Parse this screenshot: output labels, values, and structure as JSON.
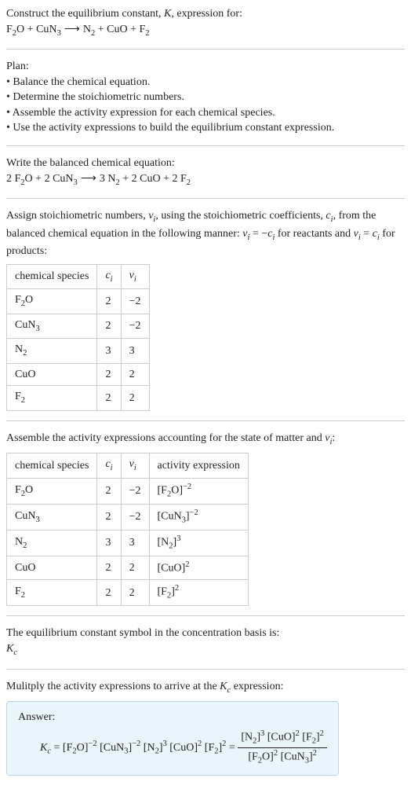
{
  "prompt": {
    "line1": "Construct the equilibrium constant, ",
    "K": "K",
    "line1b": ", expression for:"
  },
  "reaction_unbalanced": {
    "r1": "F",
    "r1s": "2",
    "r1b": "O",
    "plus1": " + ",
    "r2": "CuN",
    "r2s": "3",
    "arrow": " ⟶ ",
    "p1": "N",
    "p1s": "2",
    "plus2": " + ",
    "p2": "CuO",
    "plus3": " + ",
    "p3": "F",
    "p3s": "2"
  },
  "plan": {
    "title": "Plan:",
    "b1": "• Balance the chemical equation.",
    "b2": "• Determine the stoichiometric numbers.",
    "b3": "• Assemble the activity expression for each chemical species.",
    "b4": "• Use the activity expressions to build the equilibrium constant expression."
  },
  "balanced": {
    "title": "Write the balanced chemical equation:",
    "c1": "2 ",
    "r1": "F",
    "r1s": "2",
    "r1b": "O",
    "plus1": " + ",
    "c2": "2 ",
    "r2": "CuN",
    "r2s": "3",
    "arrow": " ⟶ ",
    "c3": "3 ",
    "p1": "N",
    "p1s": "2",
    "plus2": " + ",
    "c4": "2 ",
    "p2": "CuO",
    "plus3": " + ",
    "c5": "2 ",
    "p3": "F",
    "p3s": "2"
  },
  "assign1": {
    "t1": "Assign stoichiometric numbers, ",
    "nu": "ν",
    "nui": "i",
    "t2": ", using the stoichiometric coefficients, ",
    "c": "c",
    "ci": "i",
    "t3": ", from the balanced chemical equation in the following manner: ",
    "eq1a": "ν",
    "eq1ai": "i",
    "eq1b": " = −",
    "eq1c": "c",
    "eq1ci": "i",
    "t4": " for reactants and ",
    "eq2a": "ν",
    "eq2ai": "i",
    "eq2b": " = ",
    "eq2c": "c",
    "eq2ci": "i",
    "t5": " for products:"
  },
  "table1": {
    "h1": "chemical species",
    "h2c": "c",
    "h2i": "i",
    "h3c": "ν",
    "h3i": "i",
    "rows": [
      {
        "sp_a": "F",
        "sp_s": "2",
        "sp_b": "O",
        "c": "2",
        "v": "−2"
      },
      {
        "sp_a": "CuN",
        "sp_s": "3",
        "sp_b": "",
        "c": "2",
        "v": "−2"
      },
      {
        "sp_a": "N",
        "sp_s": "2",
        "sp_b": "",
        "c": "3",
        "v": "3"
      },
      {
        "sp_a": "CuO",
        "sp_s": "",
        "sp_b": "",
        "c": "2",
        "v": "2"
      },
      {
        "sp_a": "F",
        "sp_s": "2",
        "sp_b": "",
        "c": "2",
        "v": "2"
      }
    ]
  },
  "assemble": {
    "t1": "Assemble the activity expressions accounting for the state of matter and ",
    "nu": "ν",
    "nui": "i",
    "t2": ":"
  },
  "table2": {
    "h1": "chemical species",
    "h2c": "c",
    "h2i": "i",
    "h3c": "ν",
    "h3i": "i",
    "h4": "activity expression",
    "rows": [
      {
        "sp_a": "F",
        "sp_s": "2",
        "sp_b": "O",
        "c": "2",
        "v": "−2",
        "ae_a": "[F",
        "ae_s1": "2",
        "ae_b": "O]",
        "ae_sup": "−2"
      },
      {
        "sp_a": "CuN",
        "sp_s": "3",
        "sp_b": "",
        "c": "2",
        "v": "−2",
        "ae_a": "[CuN",
        "ae_s1": "3",
        "ae_b": "]",
        "ae_sup": "−2"
      },
      {
        "sp_a": "N",
        "sp_s": "2",
        "sp_b": "",
        "c": "3",
        "v": "3",
        "ae_a": "[N",
        "ae_s1": "2",
        "ae_b": "]",
        "ae_sup": "3"
      },
      {
        "sp_a": "CuO",
        "sp_s": "",
        "sp_b": "",
        "c": "2",
        "v": "2",
        "ae_a": "[CuO]",
        "ae_s1": "",
        "ae_b": "",
        "ae_sup": "2"
      },
      {
        "sp_a": "F",
        "sp_s": "2",
        "sp_b": "",
        "c": "2",
        "v": "2",
        "ae_a": "[F",
        "ae_s1": "2",
        "ae_b": "]",
        "ae_sup": "2"
      }
    ]
  },
  "symbol": {
    "t1": "The equilibrium constant symbol in the concentration basis is:",
    "K": "K",
    "Ks": "c"
  },
  "multiply": {
    "t1": "Mulitply the activity expressions to arrive at the ",
    "K": "K",
    "Ks": "c",
    "t2": " expression:"
  },
  "answer": {
    "label": "Answer:",
    "lhs_K": "K",
    "lhs_Ks": "c",
    "eq": " = ",
    "m1a": "[F",
    "m1s": "2",
    "m1b": "O]",
    "m1sup": "−2",
    "sp1": " ",
    "m2a": "[CuN",
    "m2s": "3",
    "m2b": "]",
    "m2sup": "−2",
    "sp2": " ",
    "m3a": "[N",
    "m3s": "2",
    "m3b": "]",
    "m3sup": "3",
    "sp3": " ",
    "m4a": "[CuO]",
    "m4sup": "2",
    "sp4": " ",
    "m5a": "[F",
    "m5s": "2",
    "m5b": "]",
    "m5sup": "2",
    "eq2": " = ",
    "num": {
      "n1a": "[N",
      "n1s": "2",
      "n1b": "]",
      "n1sup": "3",
      "sp1": " ",
      "n2a": "[CuO]",
      "n2sup": "2",
      "sp2": " ",
      "n3a": "[F",
      "n3s": "2",
      "n3b": "]",
      "n3sup": "2"
    },
    "den": {
      "d1a": "[F",
      "d1s": "2",
      "d1b": "O]",
      "d1sup": "2",
      "sp1": " ",
      "d2a": "[CuN",
      "d2s": "3",
      "d2b": "]",
      "d2sup": "2"
    }
  },
  "chart_data": {
    "type": "table",
    "tables": [
      {
        "columns": [
          "chemical species",
          "c_i",
          "ν_i"
        ],
        "rows": [
          [
            "F2O",
            2,
            -2
          ],
          [
            "CuN3",
            2,
            -2
          ],
          [
            "N2",
            3,
            3
          ],
          [
            "CuO",
            2,
            2
          ],
          [
            "F2",
            2,
            2
          ]
        ]
      },
      {
        "columns": [
          "chemical species",
          "c_i",
          "ν_i",
          "activity expression"
        ],
        "rows": [
          [
            "F2O",
            2,
            -2,
            "[F2O]^-2"
          ],
          [
            "CuN3",
            2,
            -2,
            "[CuN3]^-2"
          ],
          [
            "N2",
            3,
            3,
            "[N2]^3"
          ],
          [
            "CuO",
            2,
            2,
            "[CuO]^2"
          ],
          [
            "F2",
            2,
            2,
            "[F2]^2"
          ]
        ]
      }
    ]
  }
}
